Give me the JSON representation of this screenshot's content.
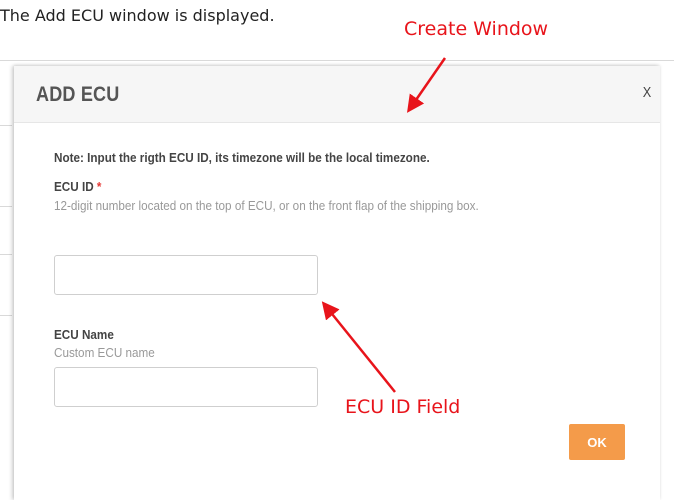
{
  "caption": "The Add ECU window is displayed.",
  "annotations": {
    "create_window": "Create Window",
    "id_field": "ECU ID Field",
    "color": "#e8141b"
  },
  "dialog": {
    "title": "ADD ECU",
    "close_label": "X",
    "note": "Note:   Input the rigth ECU ID, its timezone will be the local timezone.",
    "ecu_id": {
      "label": "ECU ID",
      "required_mark": "*",
      "help": "12-digit number located on the top of ECU, or on the front flap of the shipping box.",
      "value": "",
      "placeholder": ""
    },
    "ecu_name": {
      "label": "ECU Name",
      "help": "Custom ECU name",
      "value": "",
      "placeholder": ""
    },
    "ok_label": "OK"
  },
  "colors": {
    "ok_button": "#f49b4a",
    "required": "#e53935",
    "header_bg": "#f6f6f6"
  }
}
